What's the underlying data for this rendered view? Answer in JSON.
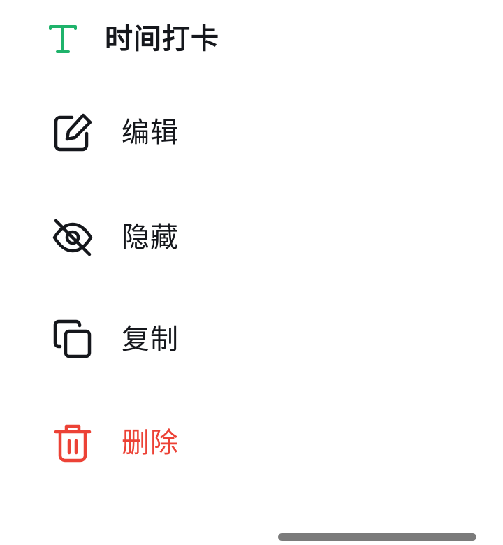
{
  "header": {
    "icon": "text-t-icon",
    "title": "时间打卡",
    "accent_color": "#1fb36b"
  },
  "menu": {
    "items": [
      {
        "id": "edit",
        "label": "编辑",
        "icon": "edit-icon"
      },
      {
        "id": "hide",
        "label": "隐藏",
        "icon": "eye-off-icon"
      },
      {
        "id": "copy",
        "label": "复制",
        "icon": "copy-icon"
      },
      {
        "id": "delete",
        "label": "删除",
        "icon": "trash-icon",
        "color": "#ec4236"
      }
    ]
  },
  "colors": {
    "text": "#15171c",
    "danger": "#ec4236",
    "background": "#ffffff",
    "home_indicator": "#7b7b7b"
  }
}
